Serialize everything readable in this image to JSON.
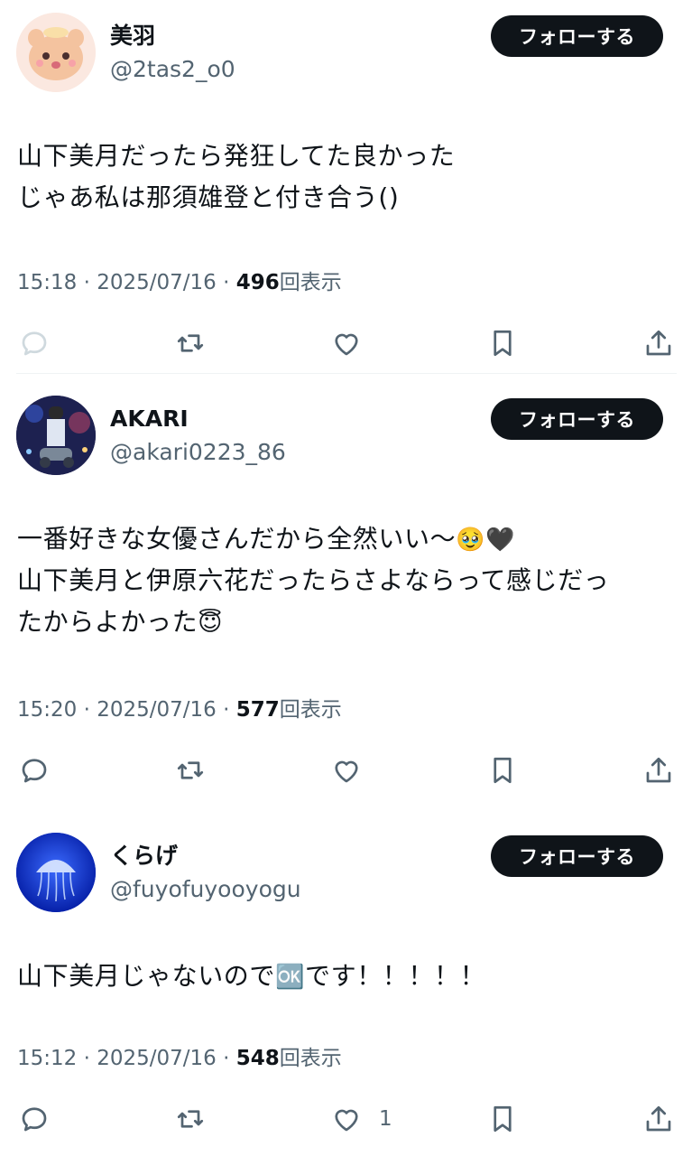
{
  "posts": [
    {
      "name": "美羽",
      "handle": "@2tas2_o0",
      "follow_label": "フォローする",
      "lines": [
        "山下美月だったら発狂してた良かった",
        "じゃあ私は那須雄登と付き合う()"
      ],
      "time": "15:18",
      "date": "2025/07/16",
      "views": "496",
      "views_label": "回表示",
      "avatar_icon": "cartoon-character-avatar",
      "reply_color": "#cfd9de"
    },
    {
      "name": "AKARI",
      "handle": "@akari0223_86",
      "follow_label": "フォローする",
      "lines": [
        "一番好きな女優さんだから全然いい〜",
        "山下美月と伊原六花だったらさよならって感じだっ",
        "たからよかった"
      ],
      "emoji_line1": "🥹🖤",
      "emoji_line3": "😇",
      "time": "15:20",
      "date": "2025/07/16",
      "views": "577",
      "views_label": "回表示",
      "avatar_icon": "concert-photo-avatar"
    },
    {
      "name": "くらげ",
      "handle": "@fuyofuyooyogu",
      "follow_label": "フォローする",
      "lines_a": "山下美月じゃないので",
      "ok_emoji": "🆗",
      "lines_b": "です！！！！！",
      "time": "15:12",
      "date": "2025/07/16",
      "views": "548",
      "views_label": "回表示",
      "like_count": "1",
      "avatar_icon": "jellyfish-avatar"
    }
  ],
  "separator": "·",
  "colors": {
    "text": "#0f1419",
    "muted": "#536471",
    "button": "#0f1419",
    "divider": "#eff3f4"
  }
}
